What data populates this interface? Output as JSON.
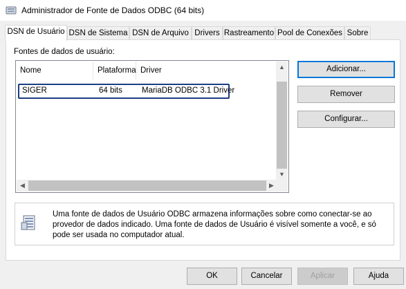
{
  "window": {
    "title": "Administrador de Fonte de Dados ODBC (64 bits)"
  },
  "tabs": [
    {
      "label": "DSN de Usuário"
    },
    {
      "label": "DSN de Sistema"
    },
    {
      "label": "DSN de Arquivo"
    },
    {
      "label": "Drivers"
    },
    {
      "label": "Rastreamento"
    },
    {
      "label": "Pool de Conexões"
    },
    {
      "label": "Sobre"
    }
  ],
  "main": {
    "section_label": "Fontes de dados de usuário:",
    "columns": [
      "Nome",
      "Plataforma",
      "Driver"
    ],
    "rows": [
      {
        "name": "SIGER",
        "platform": "64 bits",
        "driver": "MariaDB ODBC 3.1 Driver"
      }
    ]
  },
  "side_buttons": {
    "add": "Adicionar...",
    "remove": "Remover",
    "configure": "Configurar..."
  },
  "info": {
    "text": "Uma fonte de dados de Usuário ODBC armazena informações sobre como conectar-se ao provedor de dados indicado. Uma fonte de dados de Usuário é visível somente a você, e só pode ser usada no computador atual."
  },
  "footer": {
    "ok": "OK",
    "cancel": "Cancelar",
    "apply": "Aplicar",
    "help": "Ajuda"
  },
  "colors": {
    "focus_border": "#1c3d84",
    "accent": "#0078d7"
  }
}
